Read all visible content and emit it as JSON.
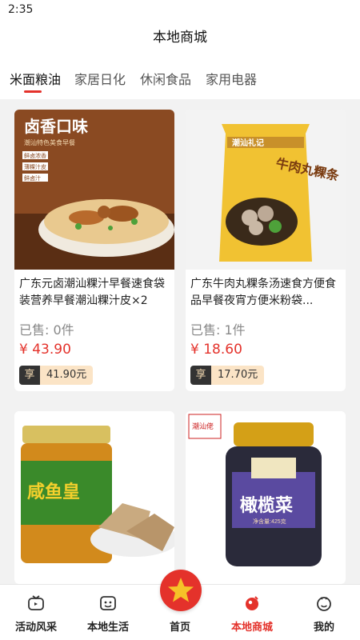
{
  "status": {
    "time": "2:35"
  },
  "header": {
    "title": "本地商城"
  },
  "tabs": [
    {
      "label": "米面粮油"
    },
    {
      "label": "家居日化"
    },
    {
      "label": "休闲食品"
    },
    {
      "label": "家用电器"
    }
  ],
  "products": [
    {
      "title": "广东元卤潮汕粿汁早餐速食袋装营养早餐潮汕粿汁皮×2",
      "sold": "已售: 0件",
      "price": "¥ 43.90",
      "share_label": "享",
      "share_price": "41.90元",
      "image_text": "卤香口味",
      "image_sub": "潮汕特色美食早餐",
      "image_tags": [
        "鲜卤浓香",
        "薄粿汁皮",
        "鲜卤汁"
      ]
    },
    {
      "title": "广东牛肉丸粿条汤速食方便食品早餐夜宵方便米粉袋...",
      "sold": "已售: 1件",
      "price": "¥ 18.60",
      "share_label": "享",
      "share_price": "17.70元",
      "image_text": "牛肉丸粿条",
      "image_brand": "潮汕礼记"
    },
    {
      "title": "",
      "image_text": "咸鱼皇"
    },
    {
      "title": "",
      "image_text": "橄榄菜",
      "image_brand": "潮汕佬",
      "image_sub": "净含量:425克"
    }
  ],
  "nav": [
    {
      "label": "活动风采",
      "icon": "tv-icon"
    },
    {
      "label": "本地生活",
      "icon": "chat-icon"
    },
    {
      "label": "首页",
      "icon": "star-icon"
    },
    {
      "label": "本地商城",
      "icon": "shop-icon"
    },
    {
      "label": "我的",
      "icon": "profile-icon"
    }
  ],
  "colors": {
    "accent": "#e4322b",
    "share_bg": "#fbe4c6"
  }
}
